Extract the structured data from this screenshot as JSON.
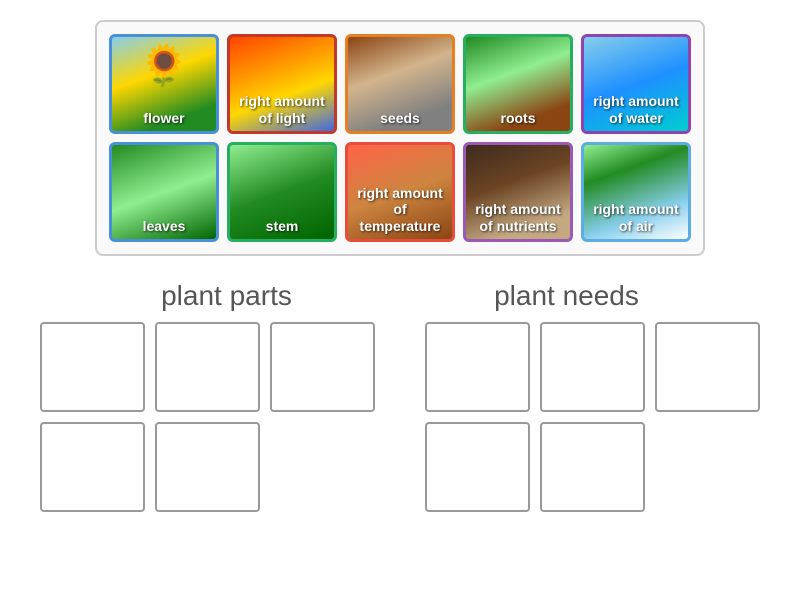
{
  "cards": {
    "row1": [
      {
        "id": "flower",
        "label": "flower",
        "cssClass": "card-flower"
      },
      {
        "id": "light",
        "label": "right amount\nof light",
        "cssClass": "card-light"
      },
      {
        "id": "seeds",
        "label": "seeds",
        "cssClass": "card-seeds"
      },
      {
        "id": "roots",
        "label": "roots",
        "cssClass": "card-roots"
      },
      {
        "id": "water",
        "label": "right amount\nof water",
        "cssClass": "card-water"
      }
    ],
    "row2": [
      {
        "id": "leaves",
        "label": "leaves",
        "cssClass": "card-leaves"
      },
      {
        "id": "stem",
        "label": "stem",
        "cssClass": "card-stem"
      },
      {
        "id": "temperature",
        "label": "right amount\nof temperature",
        "cssClass": "card-temperature"
      },
      {
        "id": "nutrients",
        "label": "right amount\nof nutrients",
        "cssClass": "card-nutrients"
      },
      {
        "id": "air",
        "label": "right amount\nof air",
        "cssClass": "card-air"
      }
    ]
  },
  "categories": {
    "plant_parts": "plant parts",
    "plant_needs": "plant needs"
  },
  "drop_zones": {
    "plant_parts_row1_count": 3,
    "plant_parts_row2_count": 2,
    "plant_needs_row1_count": 3,
    "plant_needs_row2_count": 2
  }
}
